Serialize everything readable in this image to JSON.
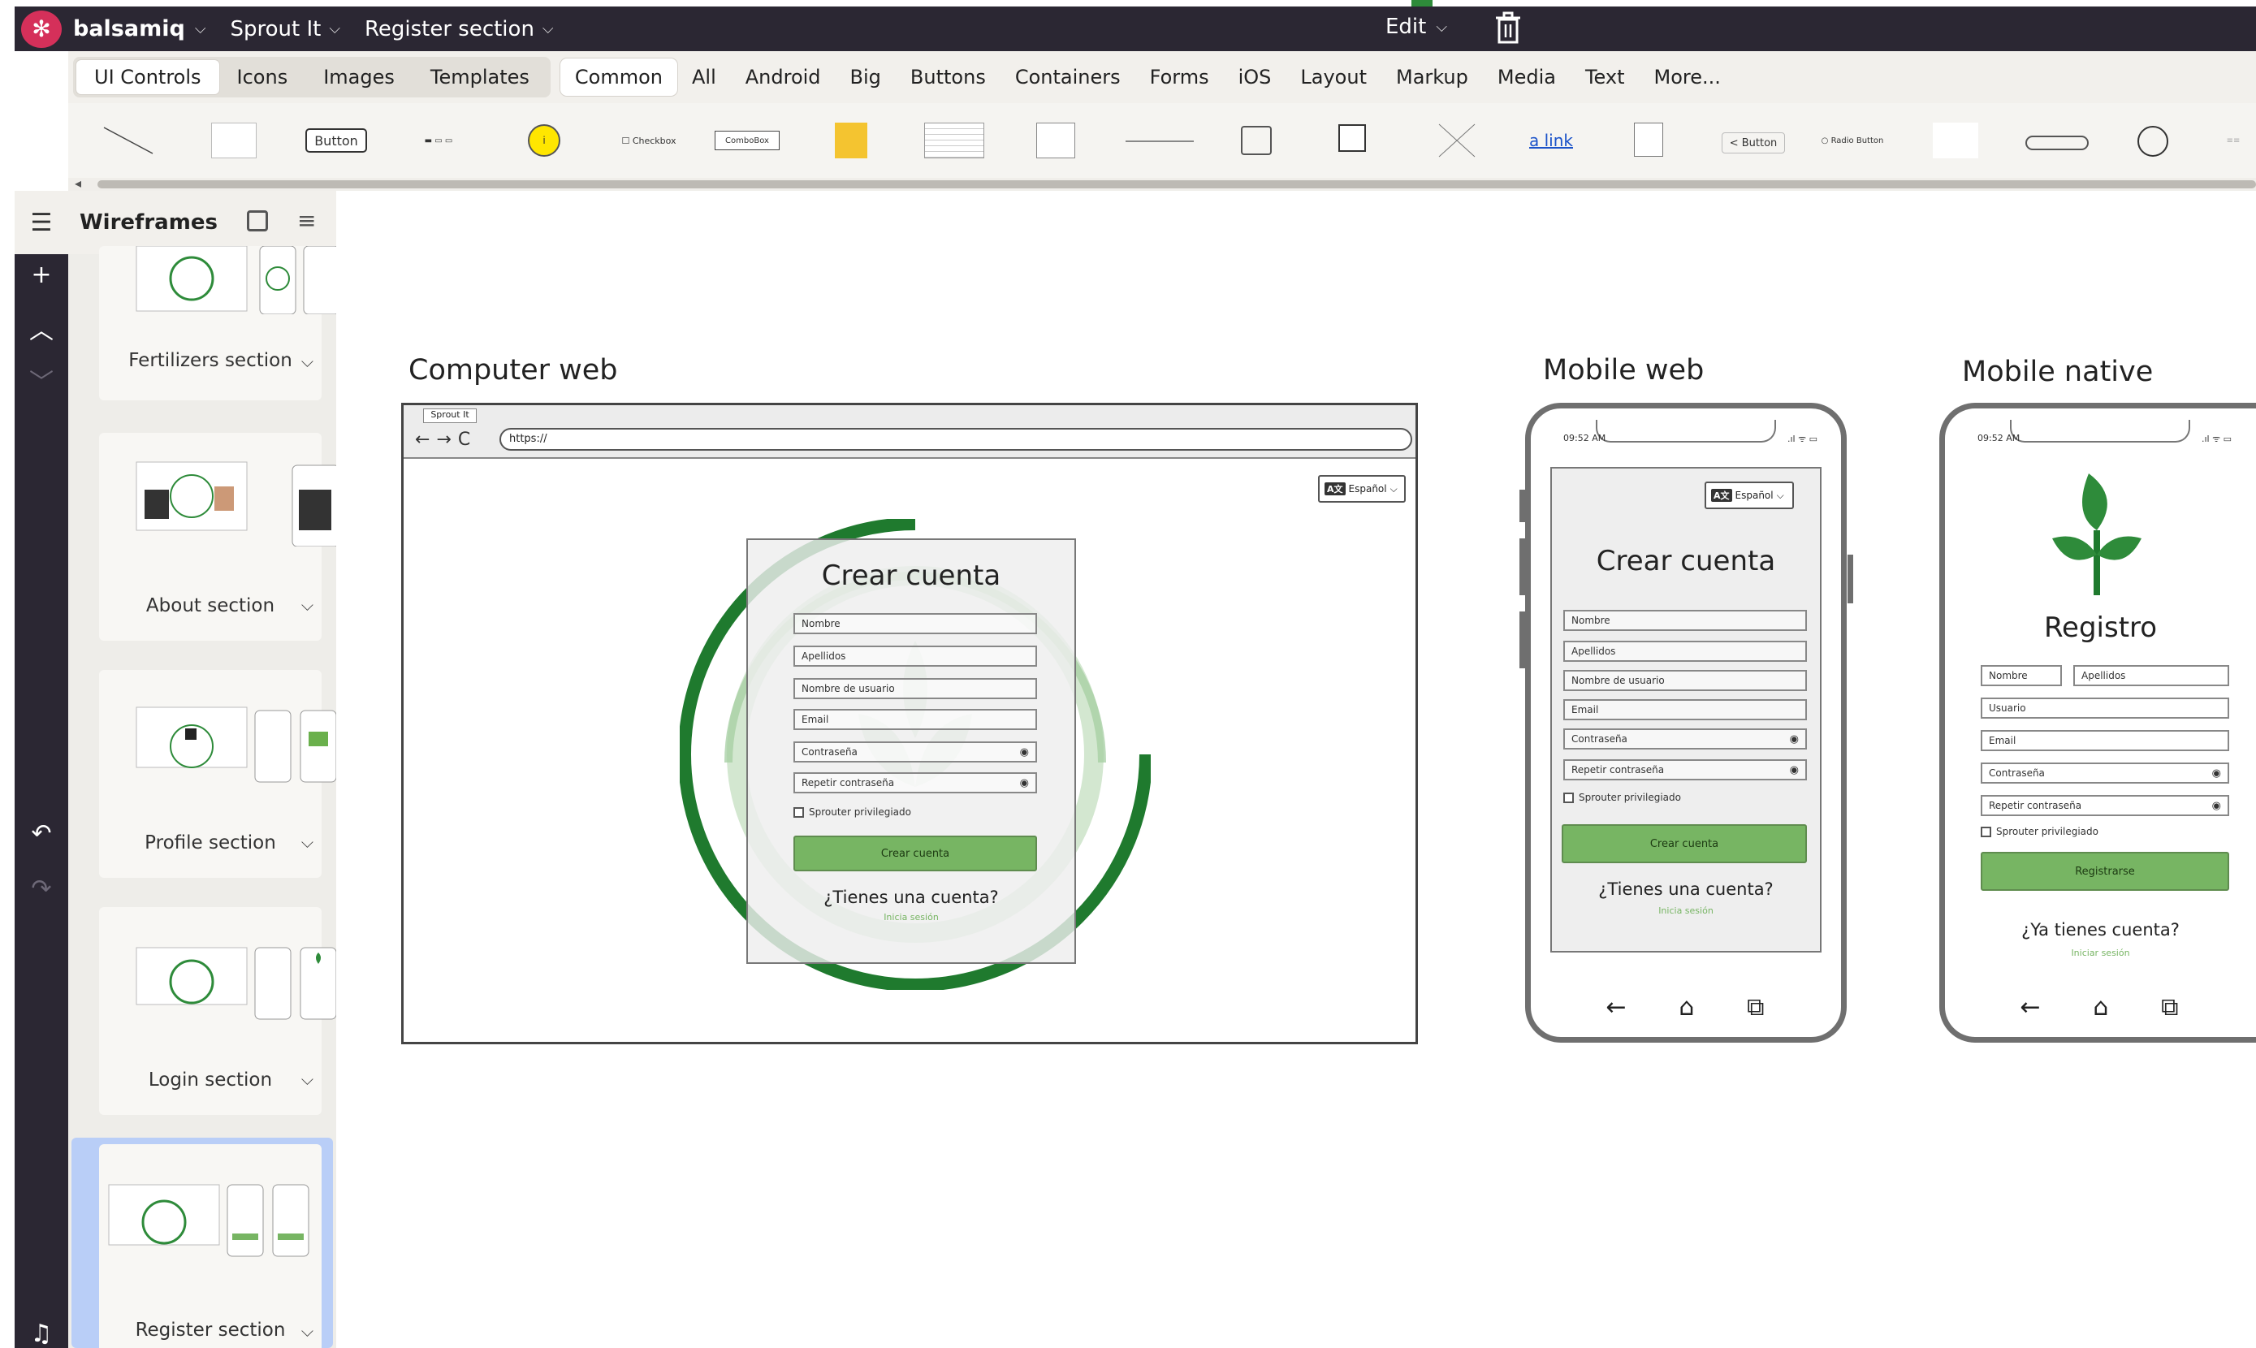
{
  "app": {
    "brand": "balsamiq",
    "menus": [
      "Sprout It",
      "Register section"
    ],
    "edit_label": "Edit"
  },
  "library_tabs": [
    "UI Controls",
    "Icons",
    "Images",
    "Templates"
  ],
  "categories": [
    "Common",
    "All",
    "Android",
    "Big",
    "Buttons",
    "Containers",
    "Forms",
    "iOS",
    "Layout",
    "Markup",
    "Media",
    "Text",
    "More..."
  ],
  "controls": {
    "button": "Button",
    "checkbox": "Checkbox",
    "combobox": "ComboBox",
    "link": "a link",
    "back_button": "< Button",
    "radio": "Radio Button"
  },
  "panel": {
    "title": "Wireframes",
    "sections": [
      "Fertilizers section",
      "About section",
      "Profile section",
      "Login section",
      "Register section"
    ]
  },
  "frames": {
    "computer": {
      "title": "Computer web",
      "tab": "Sprout It",
      "url": "https://",
      "lang": "Español",
      "lang_icon": "A文",
      "heading": "Crear cuenta",
      "fields": [
        "Nombre",
        "Apellidos",
        "Nombre de usuario",
        "Email",
        "Contraseña",
        "Repetir contraseña"
      ],
      "checkbox": "Sprouter privilegiado",
      "button": "Crear cuenta",
      "question": "¿Tienes una cuenta?",
      "link": "Inicia sesión"
    },
    "mobile_web": {
      "title": "Mobile web",
      "time": "09:52 AM",
      "lang": "Español",
      "lang_icon": "A文",
      "heading": "Crear cuenta",
      "fields": [
        "Nombre",
        "Apellidos",
        "Nombre de usuario",
        "Email",
        "Contraseña",
        "Repetir contraseña"
      ],
      "checkbox": "Sprouter privilegiado",
      "button": "Crear cuenta",
      "question": "¿Tienes una cuenta?",
      "link": "Inicia sesión"
    },
    "mobile_native": {
      "title": "Mobile native",
      "time": "09:52 AM",
      "heading": "Registro",
      "field_nombre": "Nombre",
      "field_apellidos": "Apellidos",
      "fields": [
        "Usuario",
        "Email",
        "Contraseña",
        "Repetir contraseña"
      ],
      "checkbox": "Sprouter privilegiado",
      "button": "Registrarse",
      "question": "¿Ya tienes cuenta?",
      "link": "Iniciar sesión"
    }
  },
  "colors": {
    "topbar": "#2b2733",
    "logo": "#d5305a",
    "accent_green": "#77b563",
    "selected_card": "#b9cef7"
  }
}
